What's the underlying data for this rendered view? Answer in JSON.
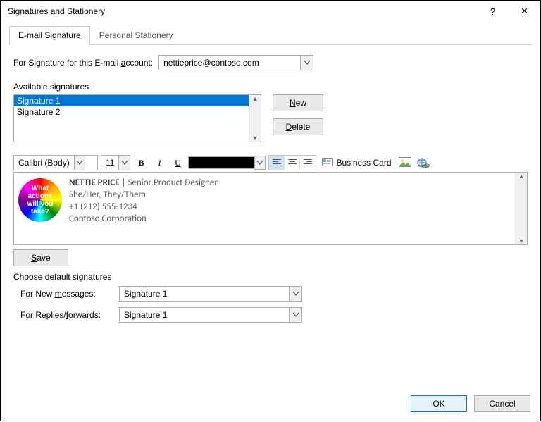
{
  "titlebar": {
    "title": "Signatures and Stationery",
    "help": "?",
    "close": "✕"
  },
  "tabs": {
    "email_sig_pre": "E",
    "email_sig_ul": "-",
    "email_sig_post": "mail Signature",
    "personal_pre": "P",
    "personal_ul": "e",
    "personal_post": "rsonal Stationery"
  },
  "account_row": {
    "label_pre": "For Signature for this  E-mail ",
    "label_ul": "a",
    "label_post": "ccount:",
    "value": "nettieprice@contoso.com"
  },
  "avail": {
    "title": "Available signatures",
    "items": [
      "Signature 1",
      "Signature 2"
    ],
    "selected_index": 0
  },
  "buttons": {
    "new_ul": "N",
    "new_post": "ew",
    "delete_ul": "D",
    "delete_post": "elete",
    "save_ul": "S",
    "save_post": "ave",
    "biz_pre": "",
    "biz_ul": "B",
    "biz_post": "usiness Card",
    "ok": "OK",
    "cancel": "Cancel"
  },
  "toolbar": {
    "font": "Calibri (Body)",
    "size": "11",
    "bold": "B",
    "italic": "I",
    "underline": "U"
  },
  "editor": {
    "badge_l1": "What",
    "badge_l2": "actions",
    "badge_l3": "will you",
    "badge_l4": "take?",
    "name": "NETTIE PRICE",
    "sep": " | ",
    "title": "Senior Product Designer",
    "pronouns": "She/Her, They/Them",
    "phone": "+1 (212) 555-1234",
    "company": "Contoso Corporation"
  },
  "defaults": {
    "title": "Choose default signatures",
    "new_label_pre": "For  New ",
    "new_label_ul": "m",
    "new_label_post": "essages:",
    "new_value": "Signature 1",
    "reply_label_pre": "For  Replies/",
    "reply_label_ul": "f",
    "reply_label_post": "orwards:",
    "reply_value": "Signature 1"
  }
}
